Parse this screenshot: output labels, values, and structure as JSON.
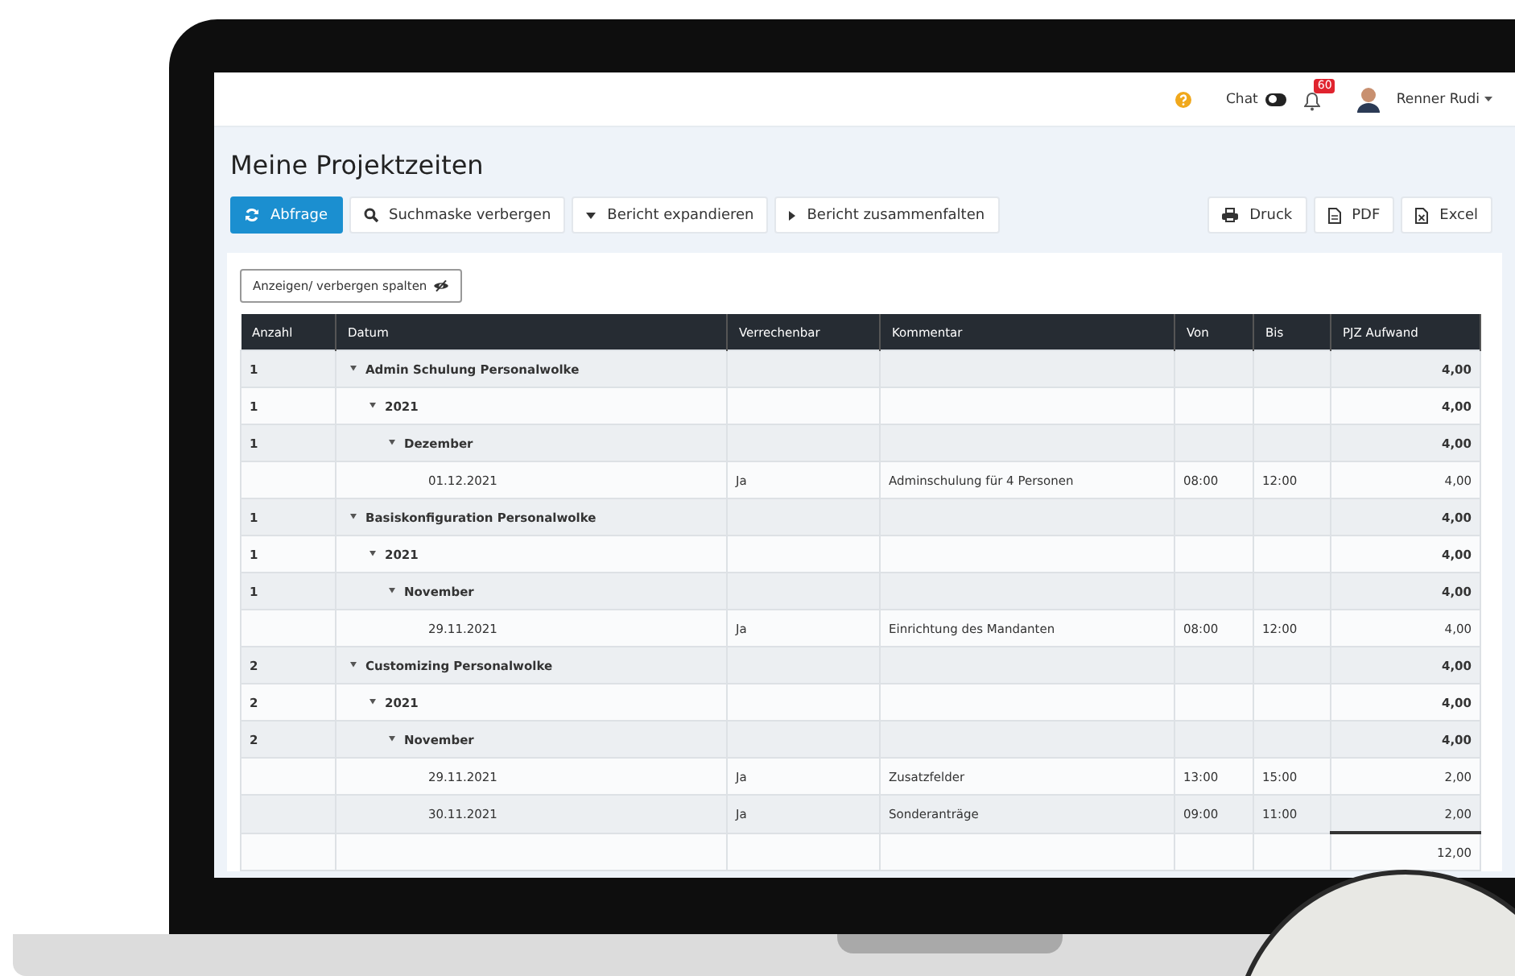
{
  "header": {
    "chat": {
      "label": "Chat",
      "on": false
    },
    "notifications": {
      "count": "60"
    },
    "user": {
      "name": "Renner Rudi"
    }
  },
  "page": {
    "title": "Meine Projektzeiten"
  },
  "toolbar": {
    "left": [
      {
        "label": "Abfrage",
        "kind": "primary"
      },
      {
        "label": "Suchmaske verbergen",
        "kind": "plain"
      },
      {
        "label": "Bericht expandieren",
        "kind": "plain"
      },
      {
        "label": "Bericht zusammenfalten",
        "kind": "plain"
      }
    ],
    "right": [
      {
        "label": "Druck",
        "kind": "plain"
      },
      {
        "label": "PDF",
        "kind": "plain"
      },
      {
        "label": "Excel",
        "kind": "plain"
      }
    ]
  },
  "columns_button": {
    "label": "Anzeigen/ verbergen spalten"
  },
  "table": {
    "columns": [
      "Anzahl",
      "Datum",
      "Verrechenbar",
      "Kommentar",
      "Von",
      "Bis",
      "PJZ Aufwand"
    ],
    "rows": [
      {
        "kind": "group",
        "count": "1",
        "label": "Admin Schulung Personalwolke",
        "total": "4,00",
        "expanded": true,
        "children": [
          {
            "kind": "group",
            "count": "1",
            "label": "2021",
            "total": "4,00",
            "expanded": true,
            "children": [
              {
                "kind": "group",
                "count": "1",
                "label": "Dezember",
                "total": "4,00",
                "expanded": true,
                "children": [
                  {
                    "kind": "entry",
                    "date": "01.12.2021",
                    "billable": "Ja",
                    "comment": "Adminschulung für 4 Personen",
                    "from": "08:00",
                    "to": "12:00",
                    "effort": "4,00"
                  }
                ]
              }
            ]
          }
        ]
      },
      {
        "kind": "group",
        "count": "1",
        "label": "Basiskonfiguration Personalwolke",
        "total": "4,00",
        "expanded": true,
        "children": [
          {
            "kind": "group",
            "count": "1",
            "label": "2021",
            "total": "4,00",
            "expanded": true,
            "children": [
              {
                "kind": "group",
                "count": "1",
                "label": "November",
                "total": "4,00",
                "expanded": true,
                "children": [
                  {
                    "kind": "entry",
                    "date": "29.11.2021",
                    "billable": "Ja",
                    "comment": "Einrichtung des Mandanten",
                    "from": "08:00",
                    "to": "12:00",
                    "effort": "4,00"
                  }
                ]
              }
            ]
          }
        ]
      },
      {
        "kind": "group",
        "count": "2",
        "label": "Customizing Personalwolke",
        "total": "4,00",
        "expanded": true,
        "children": [
          {
            "kind": "group",
            "count": "2",
            "label": "2021",
            "total": "4,00",
            "expanded": true,
            "children": [
              {
                "kind": "group",
                "count": "2",
                "label": "November",
                "total": "4,00",
                "expanded": true,
                "children": [
                  {
                    "kind": "entry",
                    "date": "29.11.2021",
                    "billable": "Ja",
                    "comment": "Zusatzfelder",
                    "from": "13:00",
                    "to": "15:00",
                    "effort": "2,00"
                  },
                  {
                    "kind": "entry",
                    "date": "30.11.2021",
                    "billable": "Ja",
                    "comment": "Sonderanträge",
                    "from": "09:00",
                    "to": "11:00",
                    "effort": "2,00"
                  }
                ]
              }
            ]
          }
        ]
      }
    ],
    "total": "12,00"
  }
}
